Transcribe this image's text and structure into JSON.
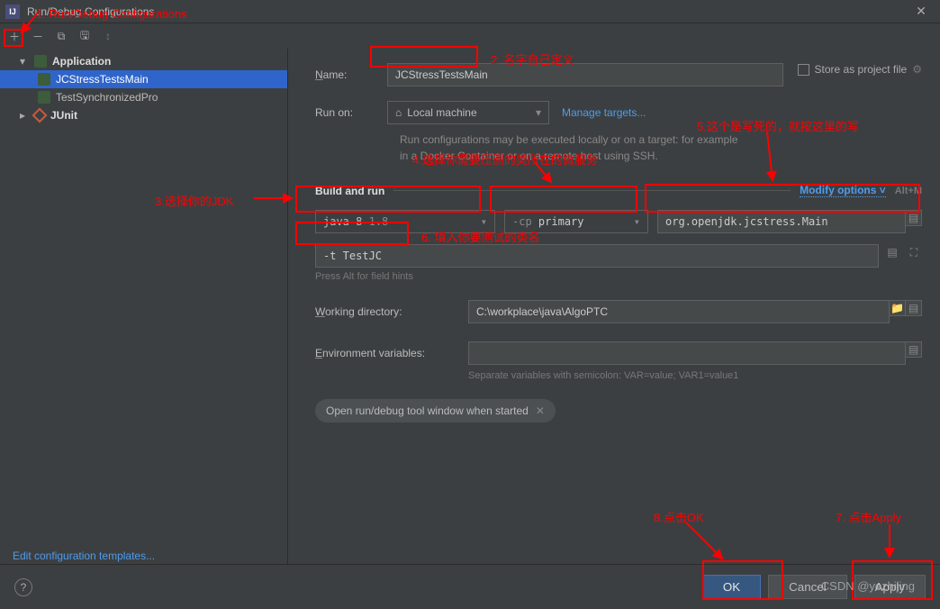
{
  "window": {
    "title": "Run/Debug Configurations"
  },
  "tree": {
    "application": "Application",
    "items": [
      "JCStressTestsMain",
      "TestSynchronizedPro"
    ],
    "junit": "JUnit"
  },
  "form": {
    "name_label": "Name:",
    "name_value": "JCStressTestsMain",
    "store_label": "Store as project file",
    "runon_label": "Run on:",
    "runon_value": "Local machine",
    "manage_targets": "Manage targets...",
    "runon_info": "Run configurations may be executed locally or on a target: for example in a Docker Container or on a remote host using SSH.",
    "build_header": "Build and run",
    "modify_options": "Modify options",
    "modify_shortcut": "Alt+M",
    "jdk": "java 8",
    "jdk_ver": "1.8",
    "cp_prefix": "-cp",
    "cp_value": "primary",
    "main_class": "org.openjdk.jcstress.Main",
    "prog_args": "-t TestJC",
    "field_hints": "Press Alt for field hints",
    "wd_label": "Working directory:",
    "wd_value": "C:\\workplace\\java\\AlgoPTC",
    "env_label": "Environment variables:",
    "env_hint": "Separate variables with semicolon: VAR=value; VAR1=value1",
    "pill_label": "Open run/debug tool window when started"
  },
  "footer": {
    "ok": "OK",
    "cancel": "Cancel",
    "apply": "Apply",
    "edit_templates": "Edit configuration templates..."
  },
  "annotations": {
    "a1": "1. Run/Debug Configurations",
    "a2": "2. 名字自己定义",
    "a3": "3.选择你的JDK",
    "a4": "4.选择你需要压测的类所在的微服务",
    "a5": "5.这个是写死的，就按这里的写",
    "a6": "6. 填入你要测试的类名",
    "a7": "7. 点击Apply",
    "a8": "8.点击OK",
    "watermark": "CSDN @yezhijing"
  }
}
